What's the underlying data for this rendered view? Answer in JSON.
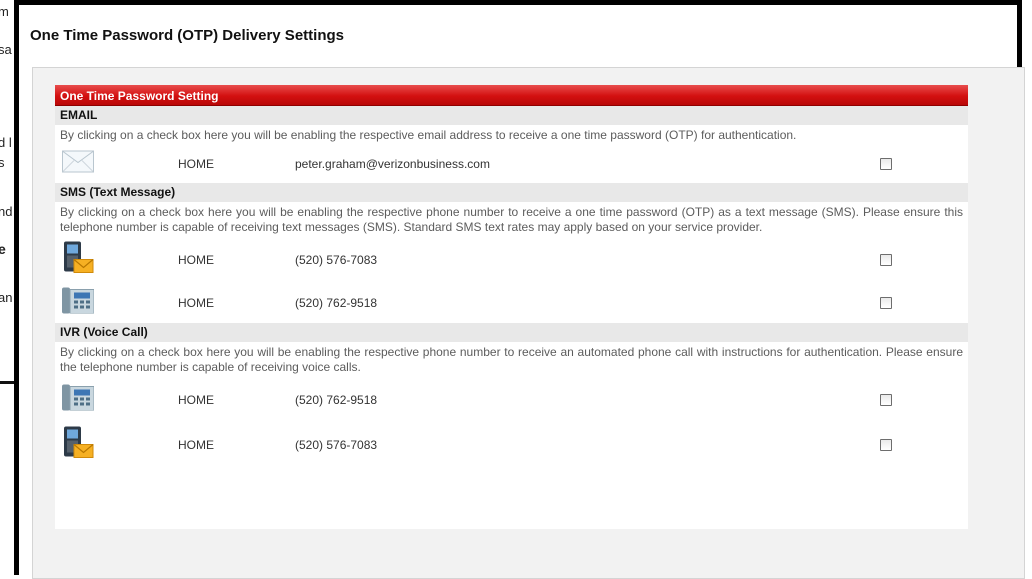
{
  "dialog": {
    "title": "One Time Password (OTP) Delivery Settings"
  },
  "section_title": "One Time Password Setting",
  "groups": [
    {
      "heading": "EMAIL",
      "description": "By clicking on a check box here you will be enabling the respective email address to receive a one time password (OTP) for authentication.",
      "items": [
        {
          "icon": "envelope-icon",
          "label": "HOME",
          "value": "peter.graham@verizonbusiness.com",
          "checked": false
        }
      ]
    },
    {
      "heading": "SMS (Text Message)",
      "description": "By clicking on a check box here you will be enabling the respective phone number to receive a one time password (OTP) as a text message (SMS). Please ensure this telephone number is capable of receiving text messages (SMS). Standard SMS text rates may apply based on your service provider.",
      "items": [
        {
          "icon": "mobile-phone-message-icon",
          "label": "HOME",
          "value": "(520) 576-7083",
          "checked": false
        },
        {
          "icon": "desk-phone-icon",
          "label": "HOME",
          "value": "(520) 762-9518",
          "checked": false
        }
      ]
    },
    {
      "heading": "IVR (Voice Call)",
      "description": "By clicking on a check box here you will be enabling the respective phone number to receive an automated phone call with instructions for authentication. Please ensure the telephone number is capable of receiving voice calls.",
      "items": [
        {
          "icon": "desk-phone-icon",
          "label": "HOME",
          "value": "(520) 762-9518",
          "checked": false
        },
        {
          "icon": "mobile-phone-message-icon",
          "label": "HOME",
          "value": "(520) 576-7083",
          "checked": false
        }
      ]
    }
  ],
  "background_fragments": [
    "m",
    "sa",
    "d l",
    "s",
    "nd",
    "e",
    "an"
  ],
  "colors": {
    "section_bar": "#d31010",
    "group_head_bg": "#e8e8e8",
    "panel_bg": "#f2f2f2"
  }
}
